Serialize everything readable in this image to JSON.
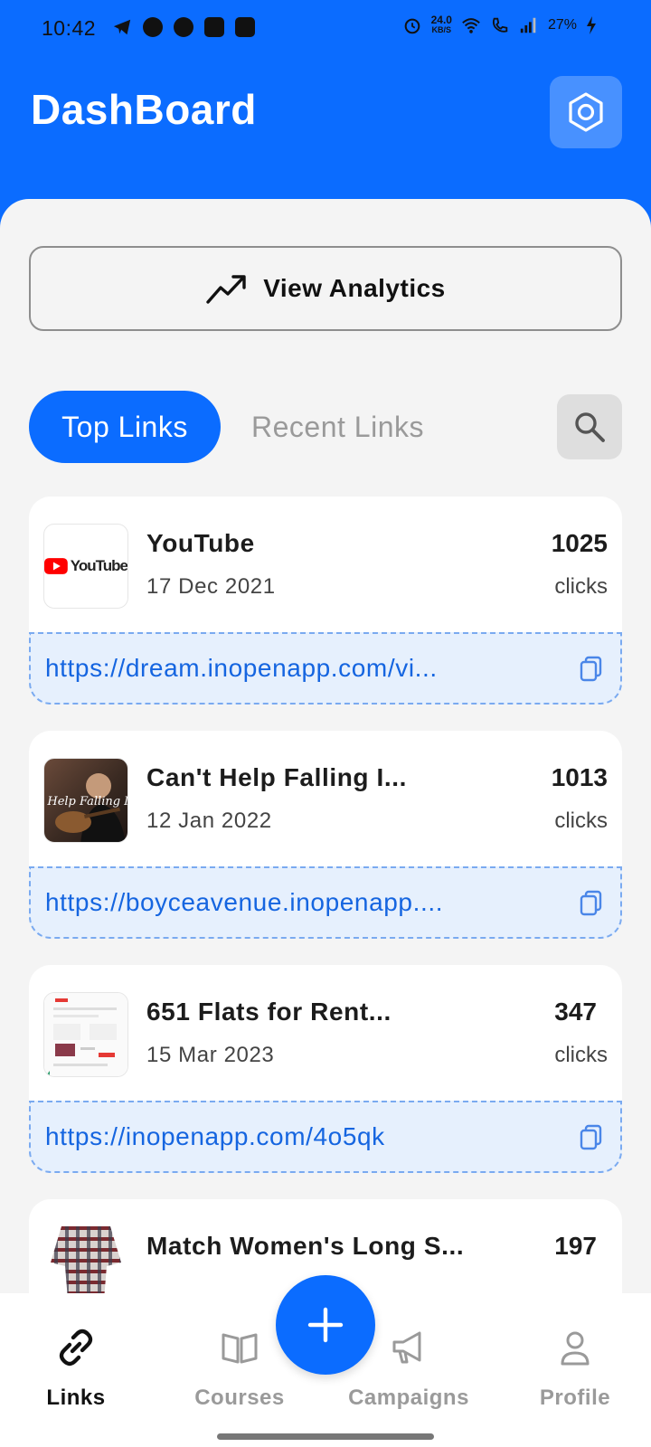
{
  "status_bar": {
    "time": "10:42",
    "net_speed_value": "24.0",
    "net_speed_unit": "KB/S",
    "battery": "27%"
  },
  "header": {
    "title": "DashBoard",
    "settings_icon": "hexagon-settings-icon"
  },
  "analytics": {
    "label": "View Analytics",
    "icon": "trending-up-icon"
  },
  "tabs": {
    "active": "Top Links",
    "inactive": "Recent Links",
    "search_icon": "search-icon"
  },
  "links": [
    {
      "title": "YouTube",
      "date": "17 Dec 2021",
      "clicks": "1025",
      "clicks_label": "clicks",
      "url": "https://dream.inopenapp.com/vi...",
      "thumb_text": "YouTube"
    },
    {
      "title": "Can't Help Falling I...",
      "date": "12 Jan 2022",
      "clicks": "1013",
      "clicks_label": "clicks",
      "url": "https://boyceavenue.inopenapp....",
      "thumb_text": "t Help Falling In"
    },
    {
      "title": "651   Flats for Rent...",
      "date": "15 Mar 2023",
      "clicks": "347",
      "clicks_label": "clicks",
      "url": "https://inopenapp.com/4o5qk"
    },
    {
      "title": "Match Women's Long S...",
      "clicks": "197"
    }
  ],
  "nav": {
    "links": "Links",
    "courses": "Courses",
    "campaigns": "Campaigns",
    "profile": "Profile"
  },
  "colors": {
    "primary": "#0b6cff",
    "background": "#f4f4f4",
    "url_text": "#1565e0",
    "url_bg": "#e6f0fd"
  }
}
